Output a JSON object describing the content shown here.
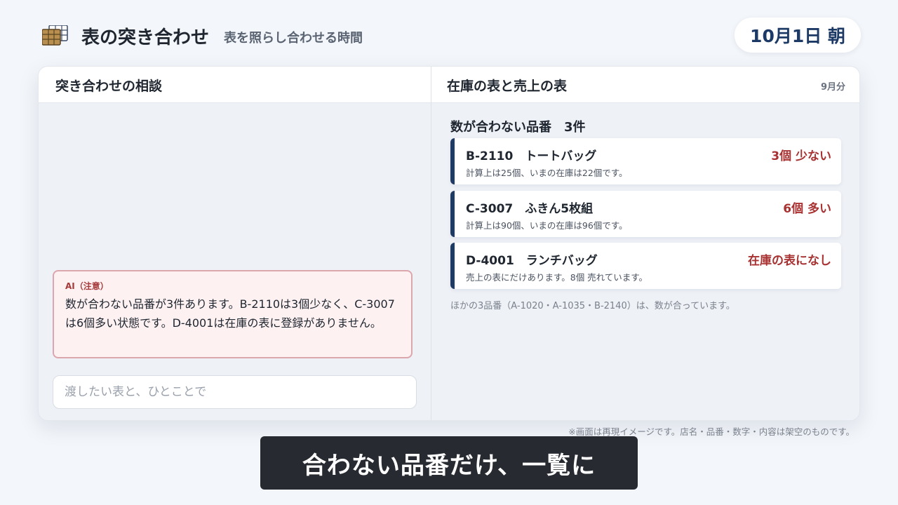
{
  "header": {
    "app_icon": "table-grid-icon",
    "title": "表の突き合わせ",
    "subtitle": "表を照らし合わせる時間",
    "date": "10月1日 朝"
  },
  "left_pane": {
    "title": "突き合わせの相談",
    "ai_message": {
      "label": "AI（注意）",
      "text": "数が合わない品番が3件あります。B-2110は3個少なく、C-3007は6個多い状態です。D-4001は在庫の表に登録がありません。"
    },
    "input": {
      "value": "",
      "placeholder": "渡したい表と、ひとことで"
    }
  },
  "right_pane": {
    "title": "在庫の表と売上の表",
    "meta": "9月分",
    "section_title": "数が合わない品番　3件",
    "items": [
      {
        "title": "B-2110　トートバッグ",
        "status": "3個 少ない",
        "detail": "計算上は25個、いまの在庫は22個です。"
      },
      {
        "title": "C-3007　ふきん5枚組",
        "status": "6個 多い",
        "detail": "計算上は90個、いまの在庫は96個です。"
      },
      {
        "title": "D-4001　ランチバッグ",
        "status": "在庫の表になし",
        "detail": "売上の表にだけあります。8個 売れています。"
      }
    ],
    "footnote": "ほかの3品番（A-1020・A-1035・B-2140）は、数が合っています。"
  },
  "disclaimer": "※画面は再現イメージです。店名・品番・数字・内容は架空のものです。",
  "caption": "合わない品番だけ、一覧に",
  "colors": {
    "accent_navy": "#1f3a63",
    "alert_red": "#a83232",
    "alert_bg": "#fdf1f1",
    "alert_border": "#dca6ad"
  }
}
